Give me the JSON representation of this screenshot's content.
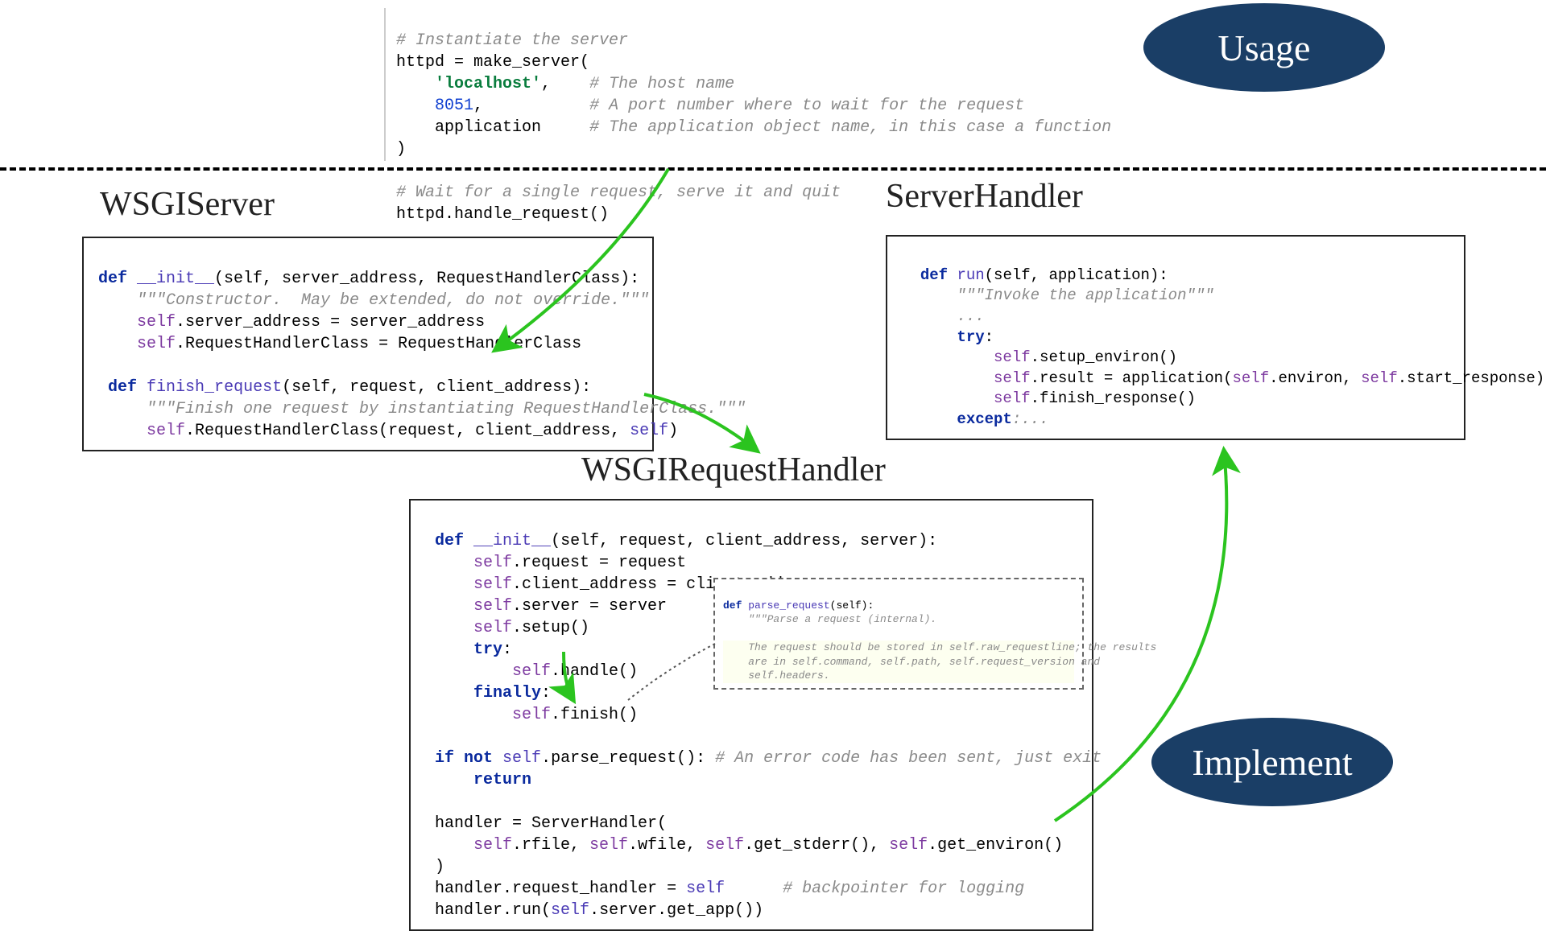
{
  "badges": {
    "usage": "Usage",
    "implement": "Implement"
  },
  "labels": {
    "wsgiserver": "WSGIServer",
    "serverhandler": "ServerHandler",
    "wsgirequesthandler": "WSGIRequestHandler"
  },
  "top_code": {
    "c1": "# Instantiate the server",
    "l2a": "httpd = make_server(",
    "l3_str": "'localhost'",
    "l3_comma": ",",
    "l3_c": "# The host name",
    "l4_num": "8051",
    "l4_comma": ",",
    "l4_c": "# A port number where to wait for the request",
    "l5_arg": "application",
    "l5_c": "# The application object name, in this case a function",
    "l6": ")",
    "c7": "# Wait for a single request, serve it and quit",
    "l8": "httpd.handle_request()"
  },
  "wsgiserver_code": {
    "def": "def",
    "init": "__init__",
    "init_params": "(self, server_address, RequestHandlerClass):",
    "doc1": "\"\"\"Constructor.  May be extended, do not override.\"\"\"",
    "l3a": "self",
    "l3b": ".server_address = server_address",
    "l4a": "self",
    "l4b": ".RequestHandlerClass = RequestHandlerClass",
    "finish": "finish_request",
    "finish_params": "(self, request, client_address):",
    "doc2": "\"\"\"Finish one request by instantiating RequestHandlerClass.\"\"\"",
    "l7a": "self",
    "l7b": ".RequestHandlerClass(request, client_address, ",
    "l7c": "self",
    "l7d": ")"
  },
  "serverhandler_code": {
    "def": "def",
    "run": "run",
    "run_params": "(self, application):",
    "doc": "\"\"\"Invoke the application\"\"\"",
    "dots1": "...",
    "try": "try",
    "colon": ":",
    "l5a": "self",
    "l5b": ".setup_environ()",
    "l6a": "self",
    "l6b": ".result = application(",
    "l6c": "self",
    "l6d": ".environ, ",
    "l6e": "self",
    "l6f": ".start_response)",
    "l7a": "self",
    "l7b": ".finish_response()",
    "except": "except",
    "dots2": ":..."
  },
  "wsgirequesthandler_code": {
    "def": "def",
    "init": "__init__",
    "init_params": "(self, request, client_address, server):",
    "l2a": "self",
    "l2b": ".request = request",
    "l3a": "self",
    "l3b": ".client_address = client_address",
    "l4a": "self",
    "l4b": ".server = server",
    "l5a": "self",
    "l5b": ".setup()",
    "try": "try",
    "colon": ":",
    "l7a": "self",
    "l7b": ".handle()",
    "finally": "finally",
    "l9a": "self",
    "l9b": ".finish()",
    "ifnot_if": "if not",
    "ifnot_self": "self",
    "ifnot_rest": ".parse_request(): ",
    "ifnot_c": "# An error code has been sent, just exit",
    "return": "return",
    "h1": "handler = ServerHandler(",
    "h2a": "self",
    "h2b": ".rfile, ",
    "h2c": "self",
    "h2d": ".wfile, ",
    "h2e": "self",
    "h2f": ".get_stderr(), ",
    "h2g": "self",
    "h2h": ".get_environ()",
    "h3": ")",
    "h4a": "handler.request_handler = ",
    "h4b": "self",
    "h4c": "      ",
    "h4d": "# backpointer for logging",
    "h5a": "handler.run(",
    "h5b": "self",
    "h5c": ".server.get_app())"
  },
  "inset": {
    "def": "def",
    "parse": "parse_request",
    "params": "(self):",
    "doc_open": "\"\"\"Parse a request (internal).",
    "doc_l2": "The request should be stored in self.raw_requestline; the results",
    "doc_l3": "are in self.command, self.path, self.request_version and",
    "doc_l4": "self.headers."
  }
}
